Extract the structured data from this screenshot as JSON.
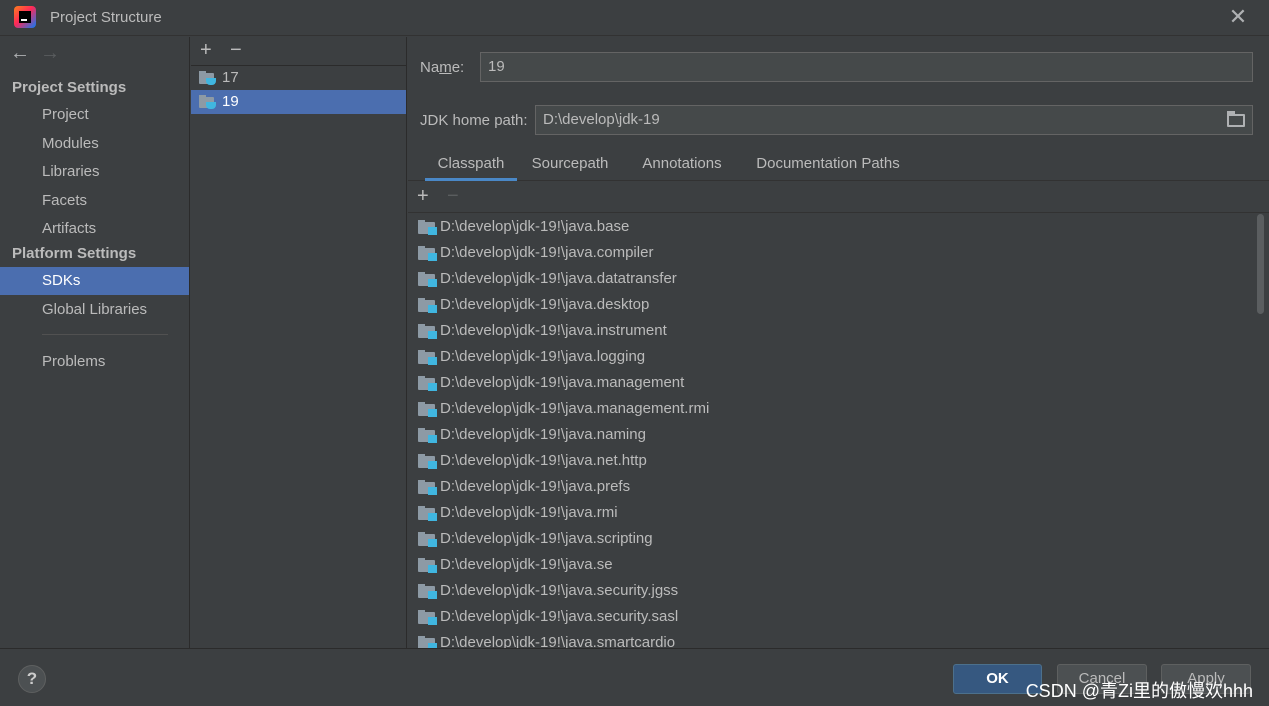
{
  "window": {
    "title": "Project Structure",
    "close_glyph": "✕"
  },
  "nav": {
    "back_glyph": "←",
    "forward_glyph": "→"
  },
  "sidebar": {
    "project_settings_header": "Project Settings",
    "platform_settings_header": "Platform Settings",
    "items": [
      {
        "label": "Project"
      },
      {
        "label": "Modules"
      },
      {
        "label": "Libraries"
      },
      {
        "label": "Facets"
      },
      {
        "label": "Artifacts"
      },
      {
        "label": "SDKs",
        "selected": true
      },
      {
        "label": "Global Libraries"
      },
      {
        "label": "Problems"
      }
    ]
  },
  "sdk_list": {
    "add_glyph": "+",
    "remove_glyph": "−",
    "items": [
      {
        "label": "17"
      },
      {
        "label": "19",
        "selected": true
      }
    ]
  },
  "details": {
    "name_label_prefix": "Na",
    "name_label_mnemonic": "m",
    "name_label_suffix": "e:",
    "name_value": "19",
    "jdk_home_label": "JDK home path:",
    "jdk_home_value": "D:\\develop\\jdk-19",
    "tabs": [
      "Classpath",
      "Sourcepath",
      "Annotations",
      "Documentation Paths"
    ],
    "active_tab": "Classpath",
    "add_glyph": "+",
    "remove_glyph": "−",
    "classpath": [
      "D:\\develop\\jdk-19!\\java.base",
      "D:\\develop\\jdk-19!\\java.compiler",
      "D:\\develop\\jdk-19!\\java.datatransfer",
      "D:\\develop\\jdk-19!\\java.desktop",
      "D:\\develop\\jdk-19!\\java.instrument",
      "D:\\develop\\jdk-19!\\java.logging",
      "D:\\develop\\jdk-19!\\java.management",
      "D:\\develop\\jdk-19!\\java.management.rmi",
      "D:\\develop\\jdk-19!\\java.naming",
      "D:\\develop\\jdk-19!\\java.net.http",
      "D:\\develop\\jdk-19!\\java.prefs",
      "D:\\develop\\jdk-19!\\java.rmi",
      "D:\\develop\\jdk-19!\\java.scripting",
      "D:\\develop\\jdk-19!\\java.se",
      "D:\\develop\\jdk-19!\\java.security.jgss",
      "D:\\develop\\jdk-19!\\java.security.sasl",
      "D:\\develop\\jdk-19!\\java.smartcardio"
    ]
  },
  "footer": {
    "help_glyph": "?",
    "ok_label": "OK",
    "cancel_label": "Cancel",
    "apply_label": "Apply",
    "watermark": "CSDN @青Zi里的傲慢欢hhh"
  },
  "colors": {
    "background": "#3c3f41",
    "selection": "#4b6eaf",
    "accent": "#4a88c7",
    "primary_button": "#365880"
  }
}
